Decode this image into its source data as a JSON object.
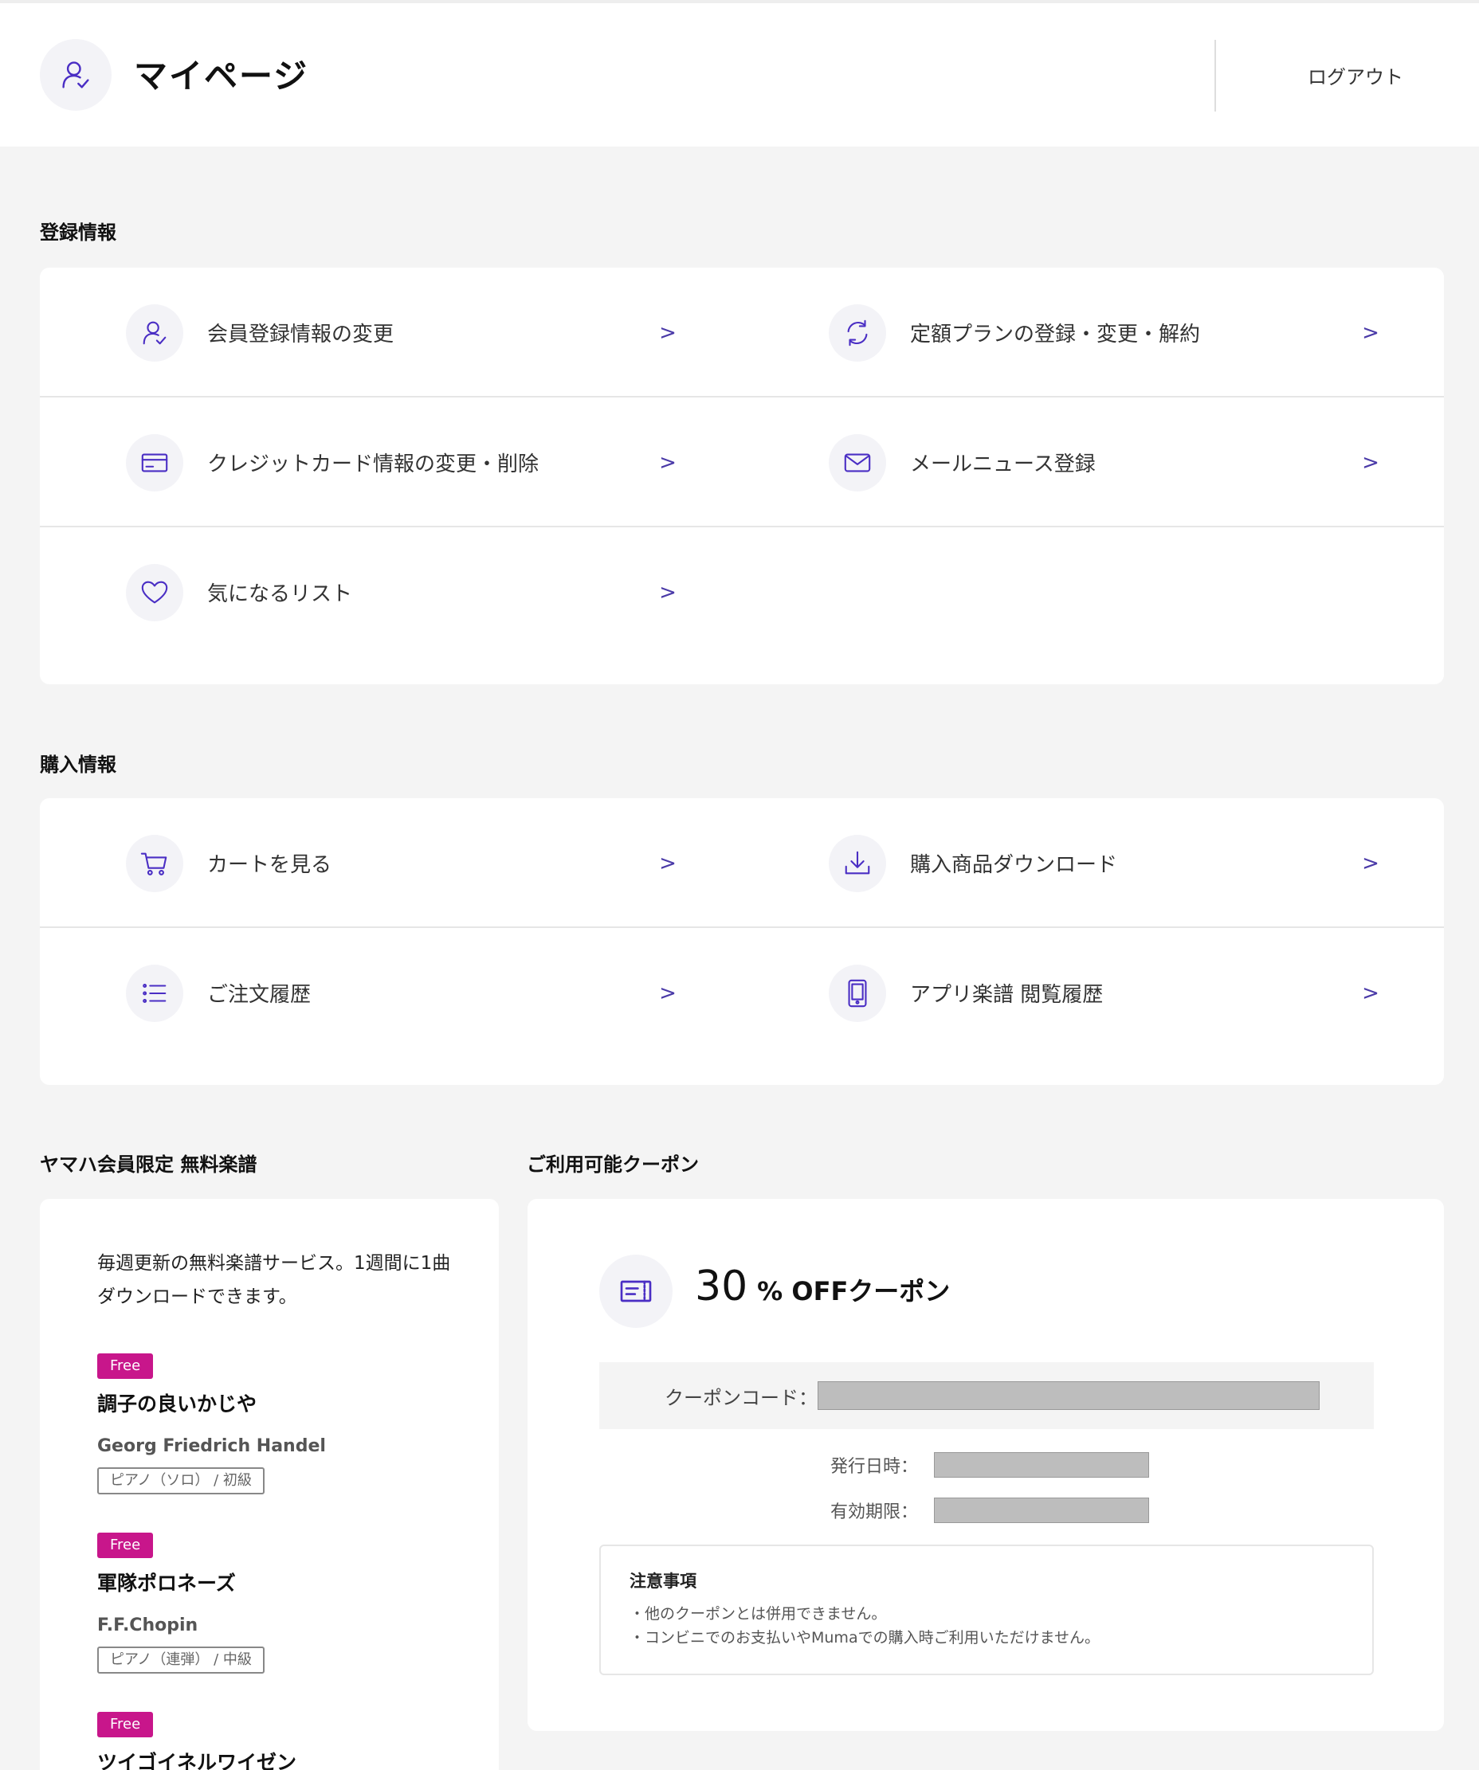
{
  "header": {
    "title": "マイページ",
    "logout": "ログアウト"
  },
  "registration": {
    "title": "登録情報",
    "items": [
      {
        "label": "会員登録情報の変更",
        "icon": "user-check-icon"
      },
      {
        "label": "定額プランの登録・変更・解約",
        "icon": "refresh-icon"
      },
      {
        "label": "クレジットカード情報の変更・削除",
        "icon": "credit-card-icon"
      },
      {
        "label": "メールニュース登録",
        "icon": "mail-icon"
      },
      {
        "label": "気になるリスト",
        "icon": "heart-icon"
      }
    ]
  },
  "purchase": {
    "title": "購入情報",
    "items": [
      {
        "label": "カートを見る",
        "icon": "cart-icon"
      },
      {
        "label": "購入商品ダウンロード",
        "icon": "download-icon"
      },
      {
        "label": "ご注文履歴",
        "icon": "list-icon"
      },
      {
        "label": "アプリ楽譜 閲覧履歴",
        "icon": "tablet-icon"
      }
    ]
  },
  "arrow": ">",
  "free_scores": {
    "title": "ヤマハ会員限定 無料楽譜",
    "description": "毎週更新の無料楽譜サービス。1週間に1曲ダウンロードできます。",
    "items": [
      {
        "badge": "Free",
        "title": "調子の良いかじや",
        "composer": "Georg Friedrich Handel",
        "tag": "ピアノ（ソロ） / 初級"
      },
      {
        "badge": "Free",
        "title": "軍隊ポロネーズ",
        "composer": "F.F.Chopin",
        "tag": "ピアノ（連弾） / 中級"
      },
      {
        "badge": "Free",
        "title": "ツイゴイネルワイゼン",
        "composer": "",
        "tag": ""
      }
    ]
  },
  "coupons": {
    "title": "ご利用可能クーポン",
    "coupon_number": "30",
    "coupon_unit": "% OFFクーポン",
    "code_label": "クーポンコード：",
    "issued_label": "発行日時：",
    "expiry_label": "有効期限：",
    "notice_title": "注意事項",
    "notices": [
      "・他のクーポンとは併用できません。",
      "・コンビニでのお支払いやMumaでの購入時ご利用いただけません。"
    ]
  }
}
